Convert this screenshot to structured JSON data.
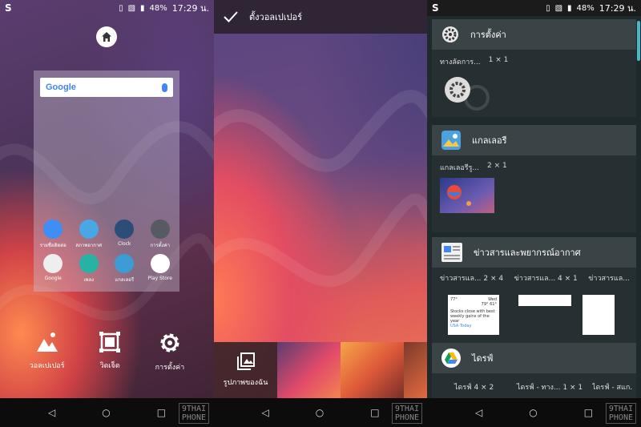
{
  "status": {
    "time": "17:29 น.",
    "battery": "48%"
  },
  "panel1": {
    "search_logo": "Google",
    "apps": [
      {
        "label": "รายชื่อติดต่อ",
        "icon": "contacts-icon",
        "color": "#3f8ef5"
      },
      {
        "label": "สภาพอากาศ",
        "icon": "weather-icon",
        "color": "#4aa7e6"
      },
      {
        "label": "Clock",
        "icon": "clock-icon",
        "color": "#2c4d78"
      },
      {
        "label": "การตั้งค่า",
        "icon": "settings-icon",
        "color": "#555b60"
      },
      {
        "label": "Google",
        "icon": "google-folder-icon",
        "color": "#eeeeee"
      },
      {
        "label": "เพลง",
        "icon": "music-icon",
        "color": "#26b3a3"
      },
      {
        "label": "แกลเลอรี",
        "icon": "gallery-icon",
        "color": "#3d9bd6"
      },
      {
        "label": "Play Store",
        "icon": "play-store-icon",
        "color": "#ffffff"
      }
    ],
    "options": {
      "wallpaper": "วอลเปเปอร์",
      "widgets": "วิดเจ็ต",
      "settings": "การตั้งค่า"
    }
  },
  "panel2": {
    "title": "ตั้งวอลเปเปอร์",
    "my_photos": "รูปภาพของฉัน"
  },
  "panel3": {
    "sections": [
      {
        "title": "การตั้งค่า",
        "icon": "settings-icon",
        "widgets": [
          {
            "name": "ทางลัดการ...",
            "size": "1 × 1"
          }
        ]
      },
      {
        "title": "แกลเลอรี",
        "icon": "gallery-icon",
        "widgets": [
          {
            "name": "แกลเลอรีรู...",
            "size": "2 × 1"
          }
        ]
      },
      {
        "title": "ข่าวสารและพยากรณ์อากาศ",
        "icon": "news-weather-icon",
        "widgets": [
          {
            "name": "ข่าวสารแล...",
            "size": "2 × 4"
          },
          {
            "name": "ข่าวสารแล...",
            "size": "4 × 1"
          },
          {
            "name": "ข่าวสารแล...",
            "size": ""
          }
        ]
      },
      {
        "title": "ไดรฟ์",
        "icon": "drive-icon",
        "widgets": [
          {
            "name": "ไดรฟ์",
            "size": "4 × 2"
          },
          {
            "name": "ไดรฟ์ - ทาง...",
            "size": "1 × 1"
          },
          {
            "name": "ไดรฟ์ - สแก...",
            "size": ""
          }
        ]
      }
    ],
    "news_card": {
      "temp_left": "77°",
      "day": "Wed",
      "temp_right": "79° 61°",
      "headline": "Stocks close with best weekly gains of the year",
      "source": "USA Today"
    }
  },
  "watermark": {
    "line1": "9THAI",
    "line2": "PHONE"
  }
}
